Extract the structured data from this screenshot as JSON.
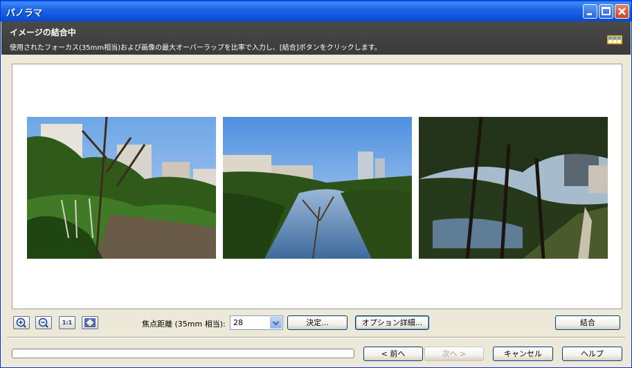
{
  "window": {
    "title": "パノラマ"
  },
  "header": {
    "title": "イメージの結合中",
    "description": "使用されたフォーカス(35mm相当)および画像の最大オーバーラップを比率で入力し、[結合]ボタンをクリックします。",
    "icon": "panorama-grid-icon"
  },
  "toolbar": {
    "zoom_in_icon": "zoom-in-icon",
    "zoom_out_icon": "zoom-out-icon",
    "actual_size_label": "1:1",
    "fit_icon": "fit-to-window-icon",
    "focal_length_label": "焦点距離 (35mm 相当):",
    "focal_length_value": "28",
    "decide_label": "決定...",
    "options_label": "オプション詳細...",
    "merge_label": "結合"
  },
  "footer": {
    "progress": 0,
    "back_label": "< 前へ",
    "next_label": "次へ >",
    "cancel_label": "キャンセル",
    "help_label": "ヘルプ"
  },
  "photos": [
    {
      "name": "photo-1",
      "scene": "trees-and-railway"
    },
    {
      "name": "photo-2",
      "scene": "river-and-buildings"
    },
    {
      "name": "photo-3",
      "scene": "park-and-wall"
    }
  ]
}
